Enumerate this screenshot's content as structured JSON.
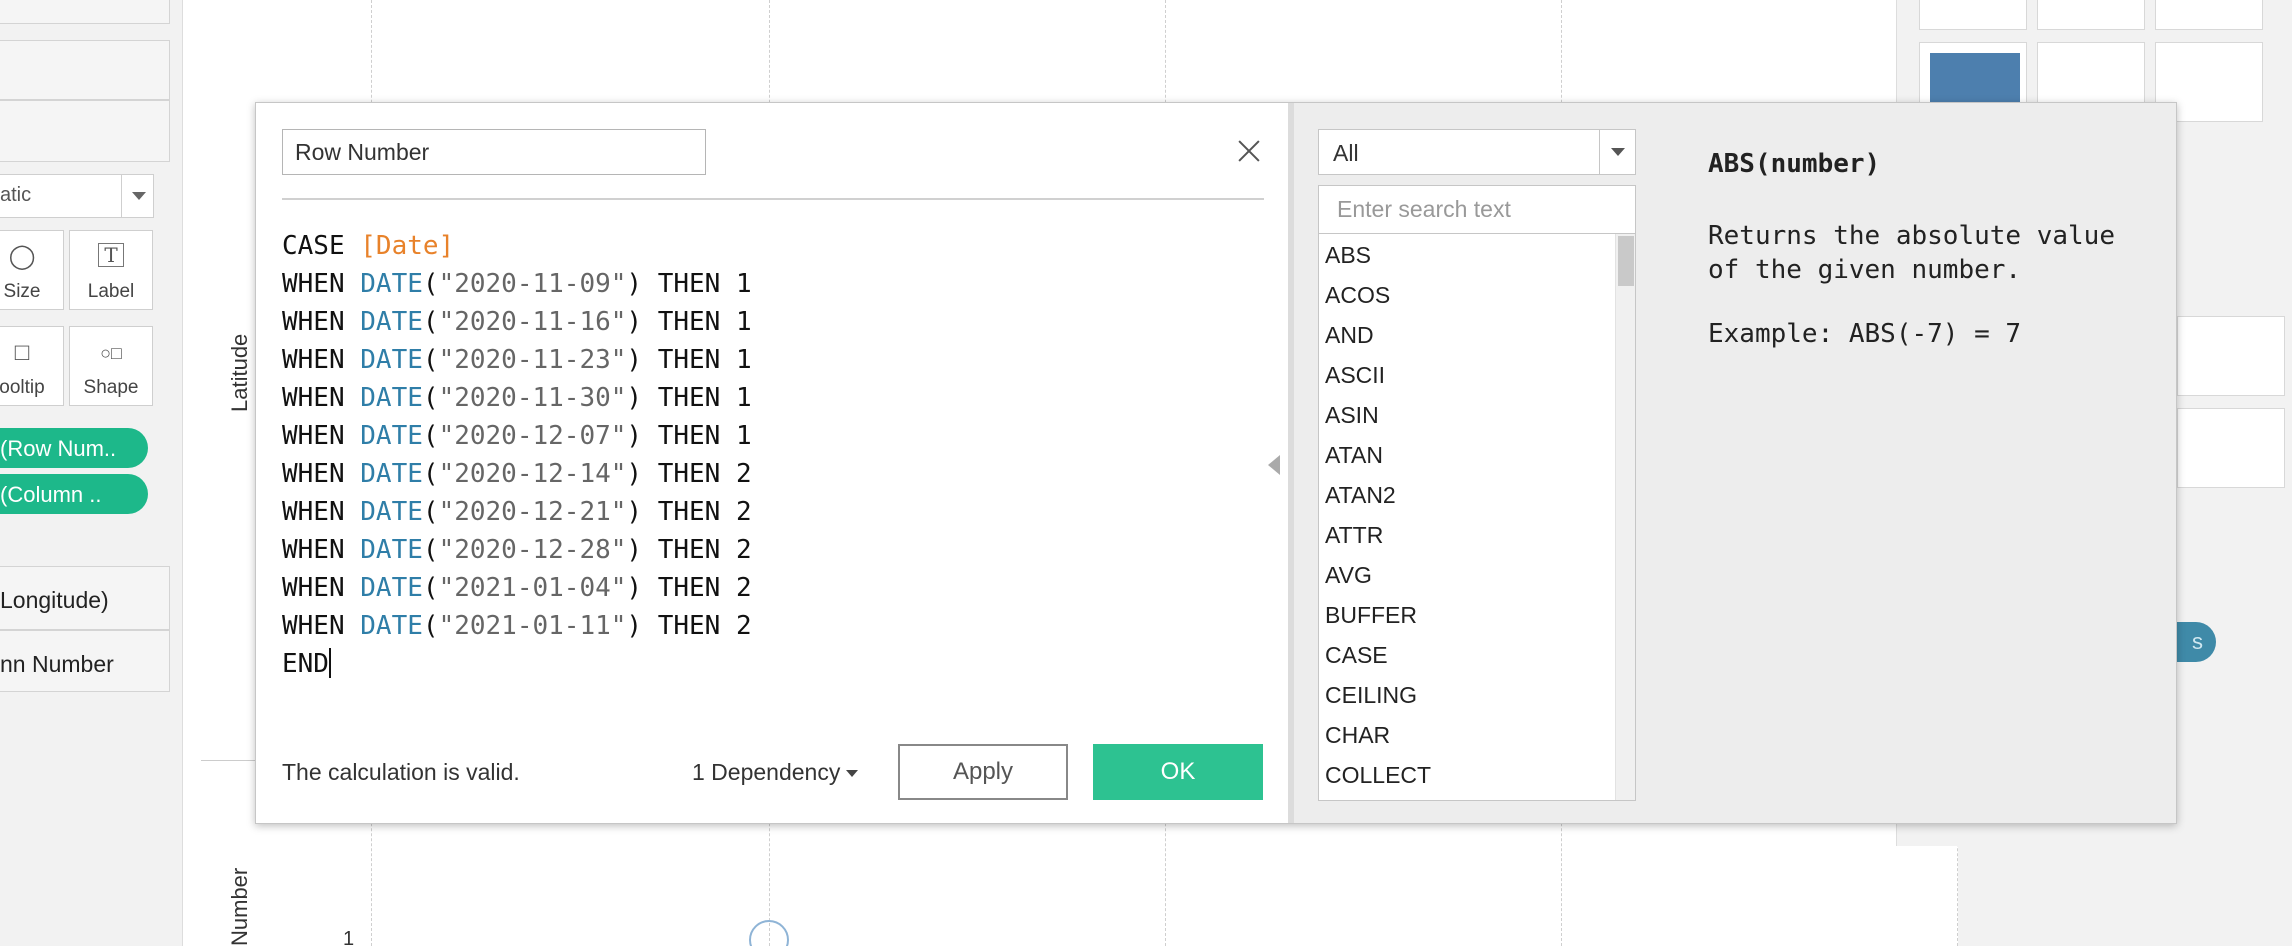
{
  "background": {
    "left_panel": {
      "select_value": "atic",
      "marks": [
        {
          "label": "Size",
          "icon": "size-icon"
        },
        {
          "label": "Label",
          "icon": "label-icon"
        },
        {
          "label": "ooltip",
          "icon": "tooltip-icon"
        },
        {
          "label": "Shape",
          "icon": "shape-icon"
        }
      ],
      "pills": [
        "(Row Num..",
        "(Column .."
      ],
      "fields": [
        "Longitude)",
        "nn Number"
      ]
    },
    "canvas": {
      "axis_top": "Latitude",
      "axis_bottom": "Number",
      "tick": "1"
    },
    "teal_pill": "s"
  },
  "dialog": {
    "calc_name": "Row Number",
    "code_lines": [
      [
        {
          "t": "CASE ",
          "c": "kw"
        },
        {
          "t": "[Date]",
          "c": "fld"
        }
      ],
      [
        {
          "t": "WHEN ",
          "c": "kw"
        },
        {
          "t": "DATE",
          "c": "fn"
        },
        {
          "t": "(",
          "c": "kw"
        },
        {
          "t": "\"2020-11-09\"",
          "c": "str"
        },
        {
          "t": ") THEN 1",
          "c": "kw"
        }
      ],
      [
        {
          "t": "WHEN ",
          "c": "kw"
        },
        {
          "t": "DATE",
          "c": "fn"
        },
        {
          "t": "(",
          "c": "kw"
        },
        {
          "t": "\"2020-11-16\"",
          "c": "str"
        },
        {
          "t": ") THEN 1",
          "c": "kw"
        }
      ],
      [
        {
          "t": "WHEN ",
          "c": "kw"
        },
        {
          "t": "DATE",
          "c": "fn"
        },
        {
          "t": "(",
          "c": "kw"
        },
        {
          "t": "\"2020-11-23\"",
          "c": "str"
        },
        {
          "t": ") THEN 1",
          "c": "kw"
        }
      ],
      [
        {
          "t": "WHEN ",
          "c": "kw"
        },
        {
          "t": "DATE",
          "c": "fn"
        },
        {
          "t": "(",
          "c": "kw"
        },
        {
          "t": "\"2020-11-30\"",
          "c": "str"
        },
        {
          "t": ") THEN 1",
          "c": "kw"
        }
      ],
      [
        {
          "t": "WHEN ",
          "c": "kw"
        },
        {
          "t": "DATE",
          "c": "fn"
        },
        {
          "t": "(",
          "c": "kw"
        },
        {
          "t": "\"2020-12-07\"",
          "c": "str"
        },
        {
          "t": ") THEN 1",
          "c": "kw"
        }
      ],
      [
        {
          "t": "WHEN ",
          "c": "kw"
        },
        {
          "t": "DATE",
          "c": "fn"
        },
        {
          "t": "(",
          "c": "kw"
        },
        {
          "t": "\"2020-12-14\"",
          "c": "str"
        },
        {
          "t": ") THEN 2",
          "c": "kw"
        }
      ],
      [
        {
          "t": "WHEN ",
          "c": "kw"
        },
        {
          "t": "DATE",
          "c": "fn"
        },
        {
          "t": "(",
          "c": "kw"
        },
        {
          "t": "\"2020-12-21\"",
          "c": "str"
        },
        {
          "t": ") THEN 2",
          "c": "kw"
        }
      ],
      [
        {
          "t": "WHEN ",
          "c": "kw"
        },
        {
          "t": "DATE",
          "c": "fn"
        },
        {
          "t": "(",
          "c": "kw"
        },
        {
          "t": "\"2020-12-28\"",
          "c": "str"
        },
        {
          "t": ") THEN 2",
          "c": "kw"
        }
      ],
      [
        {
          "t": "WHEN ",
          "c": "kw"
        },
        {
          "t": "DATE",
          "c": "fn"
        },
        {
          "t": "(",
          "c": "kw"
        },
        {
          "t": "\"2021-01-04\"",
          "c": "str"
        },
        {
          "t": ") THEN 2",
          "c": "kw"
        }
      ],
      [
        {
          "t": "WHEN ",
          "c": "kw"
        },
        {
          "t": "DATE",
          "c": "fn"
        },
        {
          "t": "(",
          "c": "kw"
        },
        {
          "t": "\"2021-01-11\"",
          "c": "str"
        },
        {
          "t": ") THEN 2",
          "c": "kw"
        }
      ],
      [
        {
          "t": "END",
          "c": "kw"
        }
      ]
    ],
    "status": "The calculation is valid.",
    "dependency": "1 Dependency",
    "apply_label": "Apply",
    "ok_label": "OK",
    "function_category": "All",
    "search_placeholder": "Enter search text",
    "functions": [
      "ABS",
      "ACOS",
      "AND",
      "ASCII",
      "ASIN",
      "ATAN",
      "ATAN2",
      "ATTR",
      "AVG",
      "BUFFER",
      "CASE",
      "CEILING",
      "CHAR",
      "COLLECT"
    ],
    "help": {
      "signature": "ABS(number)",
      "description": "Returns the absolute value of the given number.",
      "example": "Example: ABS(-7) = 7"
    }
  },
  "colors": {
    "accent_green": "#2dc291",
    "pill_green": "#1db88a",
    "code_function": "#2f7ea8",
    "code_field": "#e8822a",
    "teal_pill": "#3f8aa8"
  }
}
